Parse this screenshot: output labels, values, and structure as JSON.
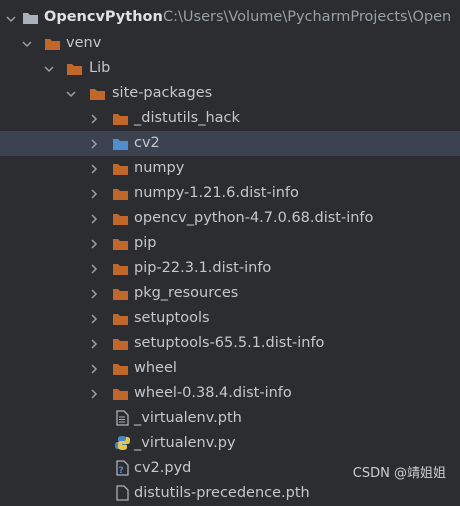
{
  "project": {
    "name": "OpencvPython",
    "path": "C:\\Users\\Volume\\PycharmProjects\\Open"
  },
  "tree": {
    "venv": "venv",
    "lib": "Lib",
    "site_packages": "site-packages",
    "items": [
      {
        "label": "_distutils_hack",
        "kind": "folder"
      },
      {
        "label": "cv2",
        "kind": "folder-package"
      },
      {
        "label": "numpy",
        "kind": "folder"
      },
      {
        "label": "numpy-1.21.6.dist-info",
        "kind": "folder"
      },
      {
        "label": "opencv_python-4.7.0.68.dist-info",
        "kind": "folder"
      },
      {
        "label": "pip",
        "kind": "folder"
      },
      {
        "label": "pip-22.3.1.dist-info",
        "kind": "folder"
      },
      {
        "label": "pkg_resources",
        "kind": "folder"
      },
      {
        "label": "setuptools",
        "kind": "folder"
      },
      {
        "label": "setuptools-65.5.1.dist-info",
        "kind": "folder"
      },
      {
        "label": "wheel",
        "kind": "folder"
      },
      {
        "label": "wheel-0.38.4.dist-info",
        "kind": "folder"
      }
    ],
    "files": [
      {
        "label": "_virtualenv.pth",
        "kind": "text-file"
      },
      {
        "label": "_virtualenv.py",
        "kind": "python-file"
      },
      {
        "label": "cv2.pyd",
        "kind": "unknown-file"
      },
      {
        "label": "distutils-precedence.pth",
        "kind": "text-file"
      }
    ]
  },
  "selected_item": "cv2",
  "watermark": "CSDN @靖姐姐",
  "colors": {
    "background": "#2b2d30",
    "folder": "#c2672a",
    "package_folder": "#4f8ecf",
    "selection": "#3d4250",
    "text": "#c4c7cc"
  }
}
